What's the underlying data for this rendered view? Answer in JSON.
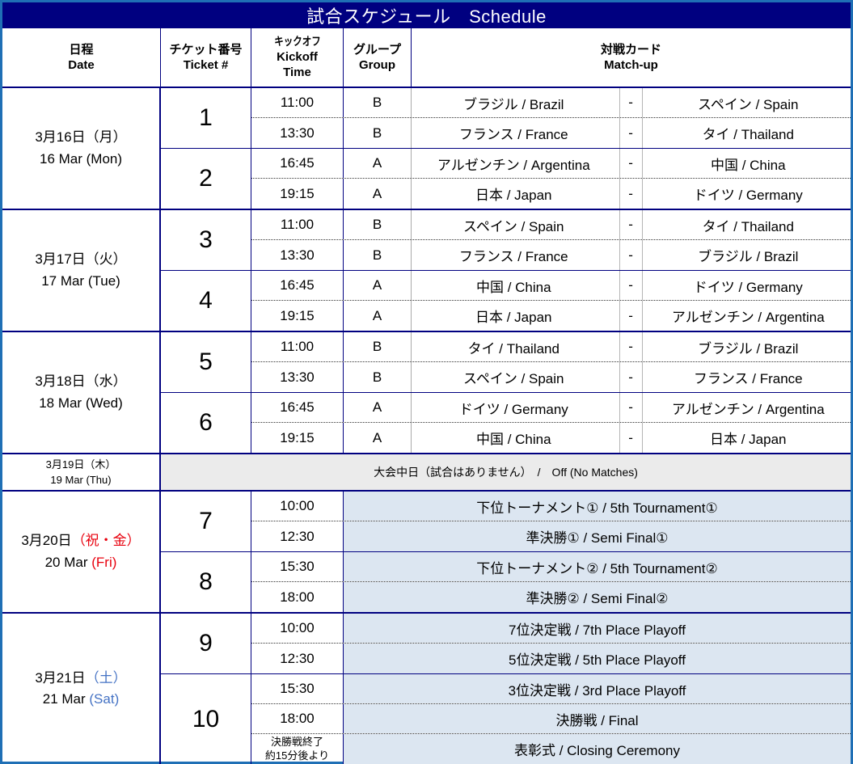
{
  "title": "試合スケジュール　Schedule",
  "colors": {
    "frame": "#1f6fb5",
    "title_bar": "#000080",
    "grid_line": "#000080",
    "offday_bg": "#ebebeb",
    "playoff_bg": "#dce6f1",
    "holiday_text": "#e8000d",
    "saturday_text": "#4472c4"
  },
  "headers": {
    "date": {
      "jp": "日程",
      "en": "Date"
    },
    "ticket": {
      "jp": "チケット番号",
      "en": "Ticket #"
    },
    "kickoff": {
      "jp": "キックオフ",
      "en": "Kickoff",
      "en2": "Time"
    },
    "group": {
      "jp": "グループ",
      "en": "Group"
    },
    "matchup": {
      "jp": "対戦カード",
      "en": "Match-up"
    }
  },
  "days": [
    {
      "date_jp": "3月16日（月）",
      "date_en": "16 Mar (Mon)",
      "date_color": "normal",
      "tickets": [
        {
          "number": "1",
          "matches": [
            {
              "time": "11:00",
              "group": "B",
              "home": "ブラジル / Brazil",
              "vs": "-",
              "away": "スペイン / Spain"
            },
            {
              "time": "13:30",
              "group": "B",
              "home": "フランス / France",
              "vs": "-",
              "away": "タイ / Thailand"
            }
          ]
        },
        {
          "number": "2",
          "matches": [
            {
              "time": "16:45",
              "group": "A",
              "home": "アルゼンチン / Argentina",
              "vs": "-",
              "away": "中国 / China"
            },
            {
              "time": "19:15",
              "group": "A",
              "home": "日本 / Japan",
              "vs": "-",
              "away": "ドイツ / Germany"
            }
          ]
        }
      ]
    },
    {
      "date_jp": "3月17日（火）",
      "date_en": "17 Mar (Tue)",
      "date_color": "normal",
      "tickets": [
        {
          "number": "3",
          "matches": [
            {
              "time": "11:00",
              "group": "B",
              "home": "スペイン / Spain",
              "vs": "-",
              "away": "タイ / Thailand"
            },
            {
              "time": "13:30",
              "group": "B",
              "home": "フランス / France",
              "vs": "-",
              "away": "ブラジル / Brazil"
            }
          ]
        },
        {
          "number": "4",
          "matches": [
            {
              "time": "16:45",
              "group": "A",
              "home": "中国 / China",
              "vs": "-",
              "away": "ドイツ / Germany"
            },
            {
              "time": "19:15",
              "group": "A",
              "home": "日本 / Japan",
              "vs": "-",
              "away": "アルゼンチン / Argentina"
            }
          ]
        }
      ]
    },
    {
      "date_jp": "3月18日（水）",
      "date_en": "18 Mar (Wed)",
      "date_color": "normal",
      "tickets": [
        {
          "number": "5",
          "matches": [
            {
              "time": "11:00",
              "group": "B",
              "home": "タイ / Thailand",
              "vs": "-",
              "away": "ブラジル / Brazil"
            },
            {
              "time": "13:30",
              "group": "B",
              "home": "スペイン / Spain",
              "vs": "-",
              "away": "フランス / France"
            }
          ]
        },
        {
          "number": "6",
          "matches": [
            {
              "time": "16:45",
              "group": "A",
              "home": "ドイツ / Germany",
              "vs": "-",
              "away": "アルゼンチン / Argentina"
            },
            {
              "time": "19:15",
              "group": "A",
              "home": "中国 / China",
              "vs": "-",
              "away": "日本 / Japan"
            }
          ]
        }
      ]
    }
  ],
  "offday": {
    "date_jp": "3月19日（木）",
    "date_en": "19 Mar (Thu)",
    "text": "大会中日（試合はありません）　/　Off (No Matches)"
  },
  "playoff_days": [
    {
      "date_jp_main": "3月20日",
      "date_jp_suffix": "（祝・金）",
      "date_en_main": "20 Mar ",
      "date_en_suffix": "(Fri)",
      "date_color": "red",
      "tickets": [
        {
          "number": "7",
          "matches": [
            {
              "time": "10:00",
              "label": "下位トーナメント① / 5th Tournament①"
            },
            {
              "time": "12:30",
              "label": "準決勝① / Semi Final①"
            }
          ]
        },
        {
          "number": "8",
          "matches": [
            {
              "time": "15:30",
              "label": "下位トーナメント② / 5th Tournament②"
            },
            {
              "time": "18:00",
              "label": "準決勝② / Semi Final②"
            }
          ]
        }
      ]
    },
    {
      "date_jp_main": "3月21日",
      "date_jp_suffix": "（土）",
      "date_en_main": "21 Mar ",
      "date_en_suffix": "(Sat)",
      "date_color": "blue",
      "tickets": [
        {
          "number": "9",
          "matches": [
            {
              "time": "10:00",
              "label": "7位決定戦 / 7th Place Playoff"
            },
            {
              "time": "12:30",
              "label": "5位決定戦 / 5th Place Playoff"
            }
          ]
        },
        {
          "number": "10",
          "matches": [
            {
              "time": "15:30",
              "label": "3位決定戦 / 3rd Place Playoff"
            },
            {
              "time": "18:00",
              "label": "決勝戦 / Final"
            },
            {
              "time_line1": "決勝戦終了",
              "time_line2": "約15分後より",
              "label": "表彰式 / Closing Ceremony"
            }
          ]
        }
      ]
    }
  ]
}
